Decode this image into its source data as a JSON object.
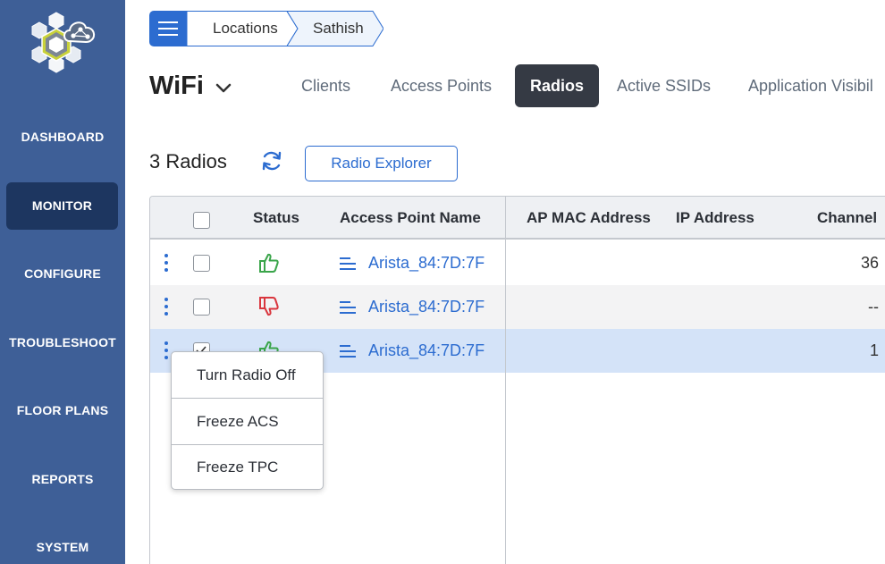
{
  "sidebar": {
    "items": [
      {
        "label": "DASHBOARD"
      },
      {
        "label": "MONITOR"
      },
      {
        "label": "CONFIGURE"
      },
      {
        "label": "TROUBLESHOOT"
      },
      {
        "label": "FLOOR PLANS"
      },
      {
        "label": "REPORTS"
      },
      {
        "label": "SYSTEM"
      }
    ],
    "active": "MONITOR"
  },
  "breadcrumb": {
    "items": [
      {
        "label": "Locations"
      },
      {
        "label": "Sathish"
      }
    ]
  },
  "header": {
    "title": "WiFi",
    "tabs": [
      {
        "label": "Clients"
      },
      {
        "label": "Access Points"
      },
      {
        "label": "Radios"
      },
      {
        "label": "Active SSIDs"
      },
      {
        "label": "Application Visibil"
      }
    ],
    "active_tab": "Radios"
  },
  "toolbar": {
    "count_label": "3 Radios",
    "explorer_label": "Radio Explorer"
  },
  "table": {
    "columns": [
      "Status",
      "Access Point Name",
      "AP MAC Address",
      "IP Address",
      "Channel"
    ],
    "rows": [
      {
        "status": "up",
        "ap_name": "Arista_84:7D:7F",
        "mac": "",
        "ip": "",
        "channel": "36",
        "checked": false
      },
      {
        "status": "down",
        "ap_name": "Arista_84:7D:7F",
        "mac": "",
        "ip": "",
        "channel": "--",
        "checked": false
      },
      {
        "status": "up",
        "ap_name": "Arista_84:7D:7F",
        "mac": "",
        "ip": "",
        "channel": "1",
        "checked": true
      }
    ]
  },
  "context_menu": {
    "items": [
      {
        "label": "Turn Radio Off"
      },
      {
        "label": "Freeze ACS"
      },
      {
        "label": "Freeze TPC"
      }
    ]
  },
  "colors": {
    "sidebar_bg": "#3e5f97",
    "sidebar_active": "#1d3660",
    "accent_blue": "#2c6cd0",
    "status_up": "#3aa54a",
    "status_down": "#d9363e",
    "selected_row": "#d4e3f8",
    "active_tab_bg": "#353a44"
  },
  "icons": {
    "logo": "cloud-hexagon-logo",
    "menu": "hamburger-icon",
    "title_dropdown": "chevron-down-icon",
    "refresh": "refresh-icon",
    "row_menu": "kebab-icon",
    "status_up": "thumbs-up-icon",
    "status_down": "thumbs-down-icon",
    "ap": "list-lines-icon"
  }
}
